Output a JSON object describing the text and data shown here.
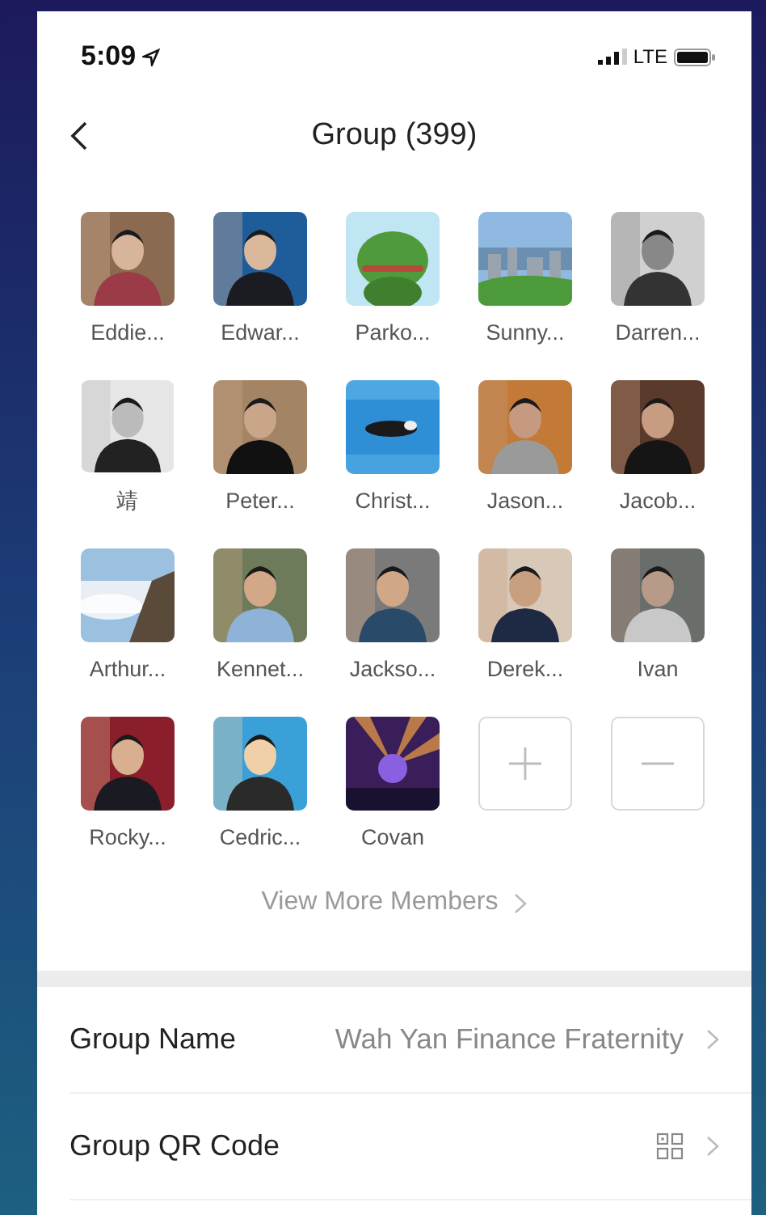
{
  "status_bar": {
    "time": "5:09",
    "network": "LTE"
  },
  "nav": {
    "title": "Group (399)"
  },
  "members": [
    {
      "name": "Eddie..."
    },
    {
      "name": "Edwar..."
    },
    {
      "name": "Parko..."
    },
    {
      "name": "Sunny..."
    },
    {
      "name": "Darren..."
    },
    {
      "name": "靖"
    },
    {
      "name": "Peter..."
    },
    {
      "name": "Christ..."
    },
    {
      "name": "Jason..."
    },
    {
      "name": "Jacob..."
    },
    {
      "name": "Arthur..."
    },
    {
      "name": "Kennet..."
    },
    {
      "name": "Jackso..."
    },
    {
      "name": "Derek..."
    },
    {
      "name": "Ivan"
    },
    {
      "name": "Rocky..."
    },
    {
      "name": "Cedric..."
    },
    {
      "name": "Covan"
    }
  ],
  "view_more": "View More Members",
  "settings": [
    {
      "kind": "text",
      "label": "Group Name",
      "value": "Wah Yan Finance Fraternity"
    },
    {
      "kind": "qr",
      "label": "Group QR Code"
    }
  ]
}
